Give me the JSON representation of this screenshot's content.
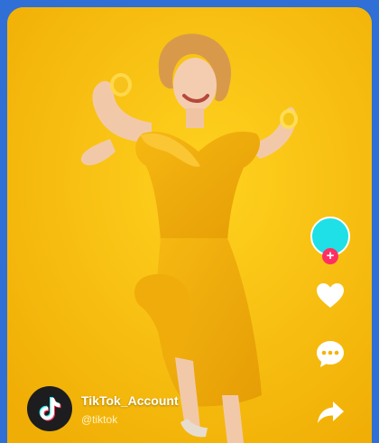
{
  "colors": {
    "frame": "#2f6fd6",
    "background": "#f8be0c",
    "dress": "#f3b00d",
    "avatar": "#1fe0e6",
    "follow_badge": "#ff2f63",
    "logo_bg": "#1d1d1f"
  },
  "video": {
    "subject": "woman-in-yellow-dress"
  },
  "actions": {
    "avatar_icon": "avatar-circle",
    "follow_symbol": "+",
    "like_icon": "heart-icon",
    "comment_icon": "comment-icon",
    "share_icon": "share-icon"
  },
  "account": {
    "name": "TikTok_Account",
    "handle": "@tiktok",
    "logo_icon": "tiktok-logo-icon"
  }
}
